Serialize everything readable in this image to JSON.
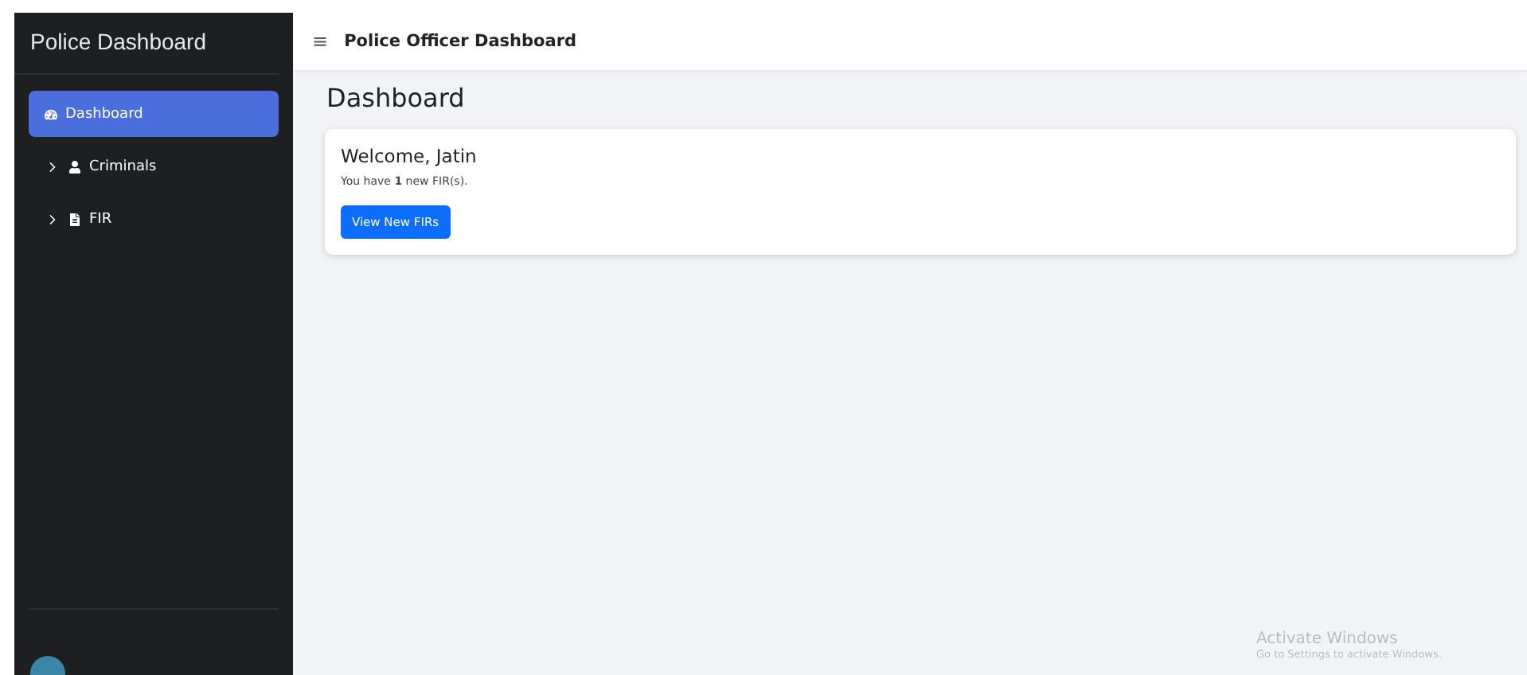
{
  "sidebar": {
    "brand": "Police Dashboard",
    "items": [
      {
        "label": "Dashboard",
        "kind": "gauge",
        "expandable": false,
        "selected": true
      },
      {
        "label": "Criminals",
        "kind": "user",
        "expandable": true,
        "selected": false
      },
      {
        "label": "FIR",
        "kind": "file",
        "expandable": true,
        "selected": false
      }
    ]
  },
  "topbar": {
    "menu_glyph": "≡",
    "title": "Police Officer Dashboard"
  },
  "page_title": "Dashboard",
  "welcome_card": {
    "heading": "Welcome, Jatin",
    "message": "You have **1** new FIR(s).",
    "button": "View New FIRs"
  },
  "os_notice": {
    "title": "Activate Windows",
    "subtitle": "Go to Settings to activate Windows."
  }
}
